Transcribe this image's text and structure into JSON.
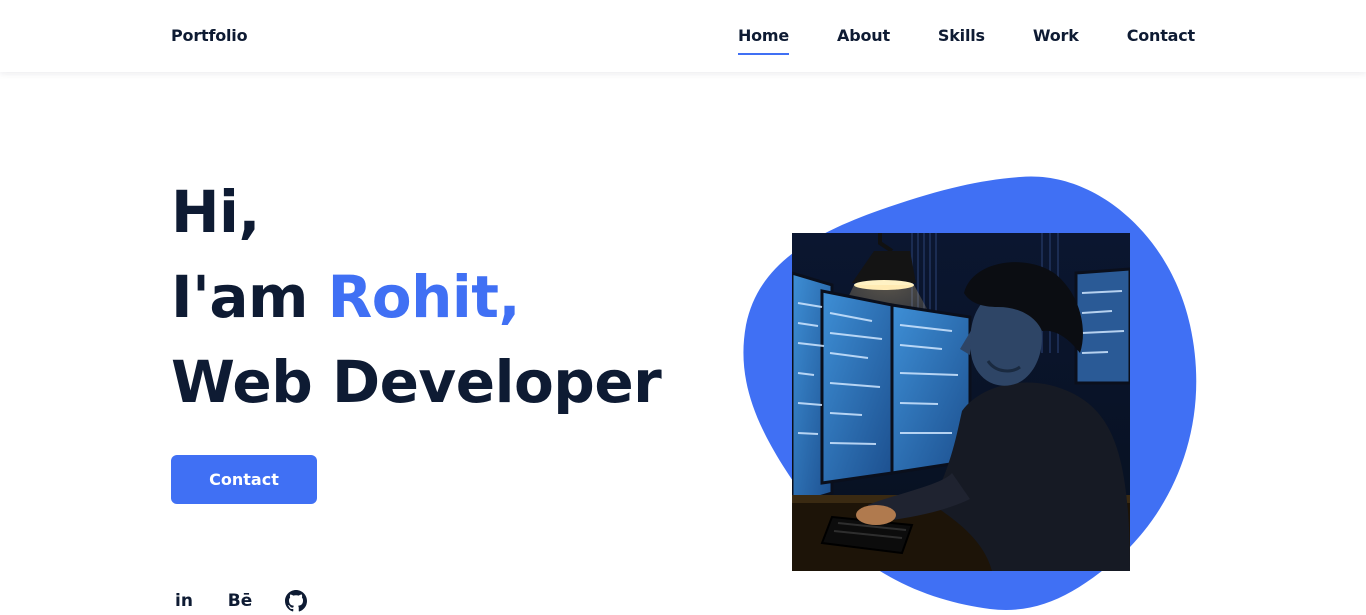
{
  "header": {
    "brand": "Portfolio",
    "nav": [
      {
        "label": "Home",
        "active": true
      },
      {
        "label": "About",
        "active": false
      },
      {
        "label": "Skills",
        "active": false
      },
      {
        "label": "Work",
        "active": false
      },
      {
        "label": "Contact",
        "active": false
      }
    ]
  },
  "hero": {
    "greeting": "Hi,",
    "intro_prefix": "I'am ",
    "name": "Rohit,",
    "role": "Web Developer",
    "cta_label": "Contact"
  },
  "socials": [
    {
      "icon": "linkedin-icon",
      "text": "in"
    },
    {
      "icon": "behance-icon",
      "text": "Bē"
    },
    {
      "icon": "github-icon"
    }
  ],
  "image": {
    "subject": "developer-at-monitors-illustration"
  },
  "colors": {
    "accent": "#4070f4",
    "title": "#0e1b33",
    "background": "#ffffff"
  }
}
